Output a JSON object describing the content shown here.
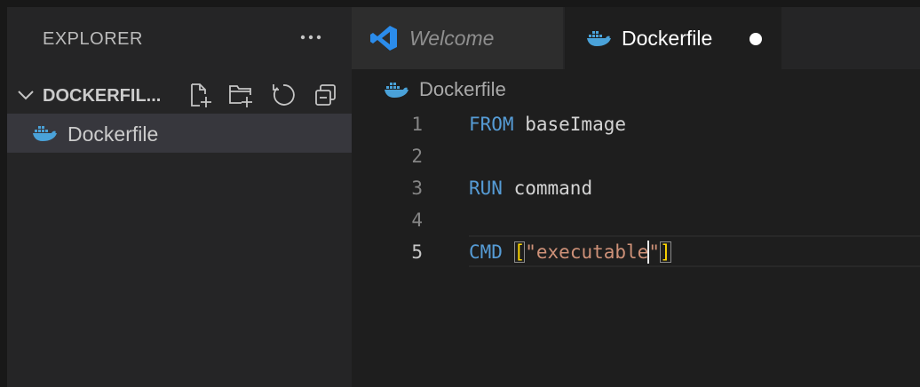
{
  "sidebar": {
    "title": "EXPLORER",
    "folder": {
      "name": "DOCKERFILE",
      "display_name": "DOCKERFIL..."
    },
    "files": [
      {
        "name": "Dockerfile",
        "icon": "docker-whale-icon",
        "selected": true
      }
    ],
    "actions": [
      "new-file-icon",
      "new-folder-icon",
      "refresh-icon",
      "collapse-all-icon"
    ]
  },
  "tabs": [
    {
      "label": "Welcome",
      "icon": "vscode-logo-icon",
      "active": false,
      "italic": true
    },
    {
      "label": "Dockerfile",
      "icon": "docker-whale-icon",
      "active": true,
      "dirty": true
    }
  ],
  "breadcrumb": {
    "file": "Dockerfile"
  },
  "editor": {
    "active_line": 5,
    "lines": [
      {
        "number": "1",
        "keyword": "FROM",
        "text": " baseImage"
      },
      {
        "number": "2"
      },
      {
        "number": "3",
        "keyword": "RUN",
        "text": " command"
      },
      {
        "number": "4"
      },
      {
        "number": "5",
        "keyword": "CMD",
        "space": " ",
        "open_bracket": "[",
        "string_a": "\"executable",
        "string_b": "\"",
        "close_bracket": "]"
      }
    ]
  },
  "colors": {
    "keyword": "#569cd6",
    "string": "#ce9178",
    "bracket": "#ffd700",
    "docker_blue": "#4aa2d9",
    "vscode_blue": "#2b8ceb"
  }
}
